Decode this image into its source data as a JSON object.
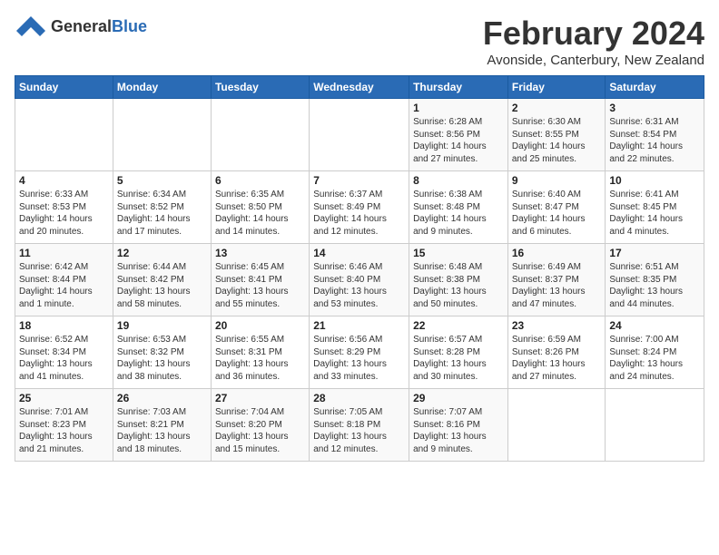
{
  "logo": {
    "general": "General",
    "blue": "Blue"
  },
  "title": "February 2024",
  "location": "Avonside, Canterbury, New Zealand",
  "days_of_week": [
    "Sunday",
    "Monday",
    "Tuesday",
    "Wednesday",
    "Thursday",
    "Friday",
    "Saturday"
  ],
  "weeks": [
    [
      {
        "day": "",
        "info": ""
      },
      {
        "day": "",
        "info": ""
      },
      {
        "day": "",
        "info": ""
      },
      {
        "day": "",
        "info": ""
      },
      {
        "day": "1",
        "info": "Sunrise: 6:28 AM\nSunset: 8:56 PM\nDaylight: 14 hours\nand 27 minutes."
      },
      {
        "day": "2",
        "info": "Sunrise: 6:30 AM\nSunset: 8:55 PM\nDaylight: 14 hours\nand 25 minutes."
      },
      {
        "day": "3",
        "info": "Sunrise: 6:31 AM\nSunset: 8:54 PM\nDaylight: 14 hours\nand 22 minutes."
      }
    ],
    [
      {
        "day": "4",
        "info": "Sunrise: 6:33 AM\nSunset: 8:53 PM\nDaylight: 14 hours\nand 20 minutes."
      },
      {
        "day": "5",
        "info": "Sunrise: 6:34 AM\nSunset: 8:52 PM\nDaylight: 14 hours\nand 17 minutes."
      },
      {
        "day": "6",
        "info": "Sunrise: 6:35 AM\nSunset: 8:50 PM\nDaylight: 14 hours\nand 14 minutes."
      },
      {
        "day": "7",
        "info": "Sunrise: 6:37 AM\nSunset: 8:49 PM\nDaylight: 14 hours\nand 12 minutes."
      },
      {
        "day": "8",
        "info": "Sunrise: 6:38 AM\nSunset: 8:48 PM\nDaylight: 14 hours\nand 9 minutes."
      },
      {
        "day": "9",
        "info": "Sunrise: 6:40 AM\nSunset: 8:47 PM\nDaylight: 14 hours\nand 6 minutes."
      },
      {
        "day": "10",
        "info": "Sunrise: 6:41 AM\nSunset: 8:45 PM\nDaylight: 14 hours\nand 4 minutes."
      }
    ],
    [
      {
        "day": "11",
        "info": "Sunrise: 6:42 AM\nSunset: 8:44 PM\nDaylight: 14 hours\nand 1 minute."
      },
      {
        "day": "12",
        "info": "Sunrise: 6:44 AM\nSunset: 8:42 PM\nDaylight: 13 hours\nand 58 minutes."
      },
      {
        "day": "13",
        "info": "Sunrise: 6:45 AM\nSunset: 8:41 PM\nDaylight: 13 hours\nand 55 minutes."
      },
      {
        "day": "14",
        "info": "Sunrise: 6:46 AM\nSunset: 8:40 PM\nDaylight: 13 hours\nand 53 minutes."
      },
      {
        "day": "15",
        "info": "Sunrise: 6:48 AM\nSunset: 8:38 PM\nDaylight: 13 hours\nand 50 minutes."
      },
      {
        "day": "16",
        "info": "Sunrise: 6:49 AM\nSunset: 8:37 PM\nDaylight: 13 hours\nand 47 minutes."
      },
      {
        "day": "17",
        "info": "Sunrise: 6:51 AM\nSunset: 8:35 PM\nDaylight: 13 hours\nand 44 minutes."
      }
    ],
    [
      {
        "day": "18",
        "info": "Sunrise: 6:52 AM\nSunset: 8:34 PM\nDaylight: 13 hours\nand 41 minutes."
      },
      {
        "day": "19",
        "info": "Sunrise: 6:53 AM\nSunset: 8:32 PM\nDaylight: 13 hours\nand 38 minutes."
      },
      {
        "day": "20",
        "info": "Sunrise: 6:55 AM\nSunset: 8:31 PM\nDaylight: 13 hours\nand 36 minutes."
      },
      {
        "day": "21",
        "info": "Sunrise: 6:56 AM\nSunset: 8:29 PM\nDaylight: 13 hours\nand 33 minutes."
      },
      {
        "day": "22",
        "info": "Sunrise: 6:57 AM\nSunset: 8:28 PM\nDaylight: 13 hours\nand 30 minutes."
      },
      {
        "day": "23",
        "info": "Sunrise: 6:59 AM\nSunset: 8:26 PM\nDaylight: 13 hours\nand 27 minutes."
      },
      {
        "day": "24",
        "info": "Sunrise: 7:00 AM\nSunset: 8:24 PM\nDaylight: 13 hours\nand 24 minutes."
      }
    ],
    [
      {
        "day": "25",
        "info": "Sunrise: 7:01 AM\nSunset: 8:23 PM\nDaylight: 13 hours\nand 21 minutes."
      },
      {
        "day": "26",
        "info": "Sunrise: 7:03 AM\nSunset: 8:21 PM\nDaylight: 13 hours\nand 18 minutes."
      },
      {
        "day": "27",
        "info": "Sunrise: 7:04 AM\nSunset: 8:20 PM\nDaylight: 13 hours\nand 15 minutes."
      },
      {
        "day": "28",
        "info": "Sunrise: 7:05 AM\nSunset: 8:18 PM\nDaylight: 13 hours\nand 12 minutes."
      },
      {
        "day": "29",
        "info": "Sunrise: 7:07 AM\nSunset: 8:16 PM\nDaylight: 13 hours\nand 9 minutes."
      },
      {
        "day": "",
        "info": ""
      },
      {
        "day": "",
        "info": ""
      }
    ]
  ]
}
